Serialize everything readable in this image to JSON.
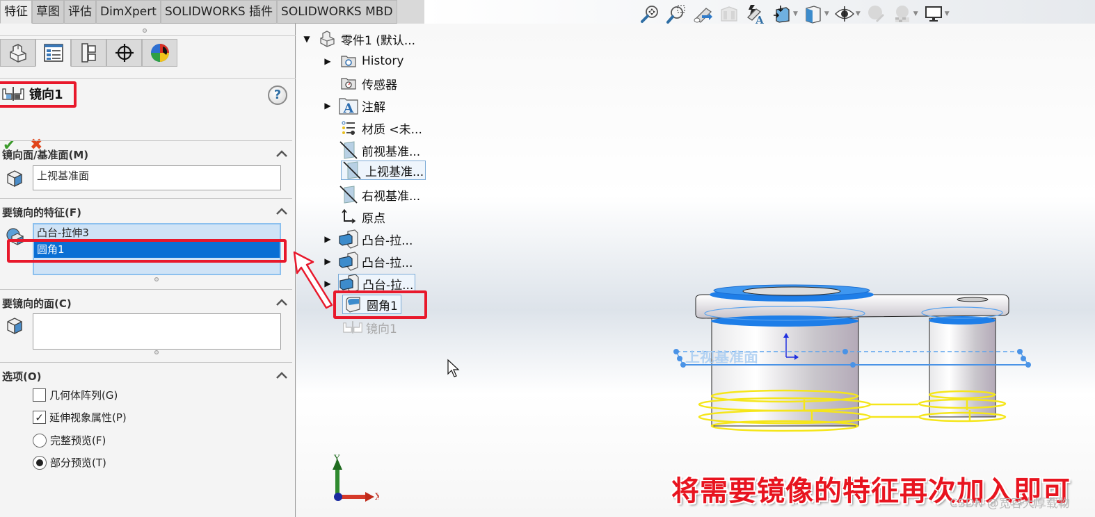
{
  "command_tabs": [
    {
      "label": "特征",
      "active": true
    },
    {
      "label": "草图",
      "active": false
    },
    {
      "label": "评估",
      "active": false
    },
    {
      "label": "DimXpert",
      "active": false
    },
    {
      "label": "SOLIDWORKS 插件",
      "active": false
    },
    {
      "label": "SOLIDWORKS MBD",
      "active": false
    }
  ],
  "manager_tabs": [
    {
      "name": "featuremanager",
      "icon": "part-tree-icon"
    },
    {
      "name": "propertymanager",
      "icon": "property-list-icon",
      "active": true
    },
    {
      "name": "configurationmanager",
      "icon": "configuration-icon"
    },
    {
      "name": "dimxpertmanager",
      "icon": "crosshair-icon"
    },
    {
      "name": "displaymanager",
      "icon": "appearance-sphere-icon"
    }
  ],
  "property_manager": {
    "title": "镜向1",
    "help_label": "?",
    "ok_label": "✔",
    "cancel_label": "✖",
    "sections": {
      "mirror_plane": {
        "heading": "镜向面/基准面(M)",
        "value": "上视基准面"
      },
      "features": {
        "heading": "要镜向的特征(F)",
        "items": [
          {
            "label": "凸台-拉伸3",
            "selected": false
          },
          {
            "label": "圆角1",
            "selected": true
          }
        ]
      },
      "faces": {
        "heading": "要镜向的面(C)",
        "value": ""
      },
      "options": {
        "heading": "选项(O)",
        "checkboxes": [
          {
            "label": "几何体阵列(G)",
            "checked": false
          },
          {
            "label": "延伸视象属性(P)",
            "checked": true
          }
        ],
        "radios": [
          {
            "label": "完整预览(F)",
            "selected": false
          },
          {
            "label": "部分预览(T)",
            "selected": true
          }
        ]
      }
    }
  },
  "feature_tree": [
    {
      "label": "零件1 (默认...",
      "icon": "part-icon",
      "expander": "▼"
    },
    {
      "label": "History",
      "icon": "history-folder-icon",
      "expander": "▶"
    },
    {
      "label": "传感器",
      "icon": "sensor-folder-icon",
      "expander": ""
    },
    {
      "label": "注解",
      "icon": "annotation-icon",
      "expander": "▶"
    },
    {
      "label": "材质 <未...",
      "icon": "material-icon",
      "expander": ""
    },
    {
      "label": "前视基准...",
      "icon": "plane-icon",
      "expander": ""
    },
    {
      "label": "上视基准...",
      "icon": "plane-icon",
      "expander": "",
      "highlighted": true
    },
    {
      "label": "右视基准...",
      "icon": "plane-icon",
      "expander": ""
    },
    {
      "label": "原点",
      "icon": "origin-icon",
      "expander": ""
    },
    {
      "label": "凸台-拉...",
      "icon": "boss-extrude-icon",
      "expander": "▶"
    },
    {
      "label": "凸台-拉...",
      "icon": "boss-extrude-icon",
      "expander": "▶"
    },
    {
      "label": "凸台-拉...",
      "icon": "boss-extrude-icon",
      "expander": "▶",
      "highlighted": true
    },
    {
      "label": "圆角1",
      "icon": "fillet-icon",
      "expander": "",
      "highlighted": true
    },
    {
      "label": "镜向1",
      "icon": "mirror-icon",
      "expander": "",
      "dim": true
    }
  ],
  "viewport": {
    "plane_label": "上视基准面",
    "triad": {
      "x_label": "X",
      "y_label": "Y"
    },
    "colors": {
      "preview_yellow": "#f5e61a",
      "selection_blue": "#1e7ee8",
      "annotation_red": "#e8182b"
    }
  },
  "heads_up_toolbar": [
    "zoom-to-fit-icon",
    "zoom-to-area-icon",
    "previous-view-icon",
    "section-view-icon",
    "dynamic-annotation-icon",
    "view-orientation-icon",
    "display-style-icon",
    "hide-show-items-icon",
    "edit-appearance-icon",
    "apply-scene-icon",
    "view-settings-icon"
  ],
  "caption": "将需要镜像的特征再次加入即可",
  "watermark": "CSDN @宽容大厚载物"
}
